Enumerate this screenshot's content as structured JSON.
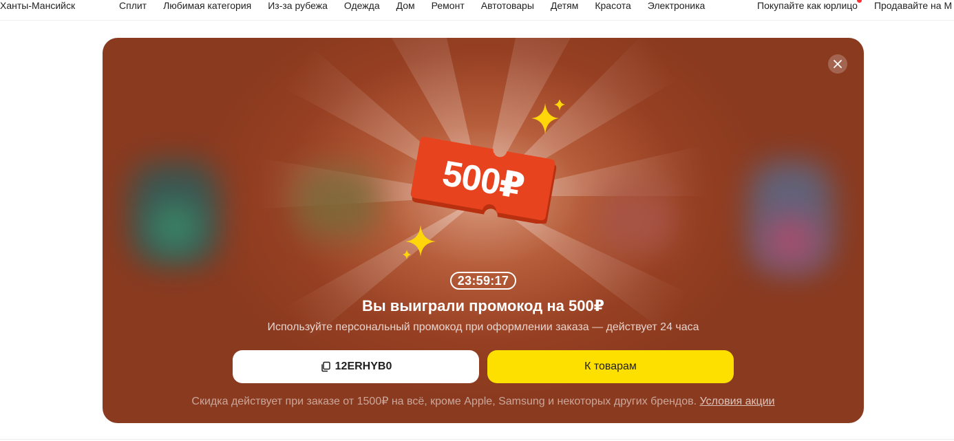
{
  "topbar": {
    "city": "Ханты-Мансийск",
    "nav": [
      "Сплит",
      "Любимая категория",
      "Из-за рубежа",
      "Одежда",
      "Дом",
      "Ремонт",
      "Автотовары",
      "Детям",
      "Красота",
      "Электроника"
    ],
    "right": [
      "Покупайте как юрлицо",
      "Продавайте на М"
    ]
  },
  "promo": {
    "ticket_amount": "500₽",
    "timer": "23:59:17",
    "title": "Вы выиграли промокод на 500₽",
    "subtitle": "Используйте персональный промокод при оформлении заказа — действует 24 часа",
    "code": "12ERHYB0",
    "cta": "К товарам",
    "footnote": "Скидка действует при заказе от 1500₽ на всё, кроме Apple, Samsung и некоторых других брендов.",
    "terms_link": "Условия акции"
  },
  "icons": {
    "close": "close-icon",
    "copy": "copy-icon",
    "sparkle": "sparkle-icon",
    "notification": "notification-dot"
  },
  "colors": {
    "modal_bg": "#963f22",
    "cta_yellow": "#fee000",
    "ticket_red": "#e8431f",
    "sparkle_yellow": "#ffd60a",
    "notification_red": "#ff2d2d"
  }
}
